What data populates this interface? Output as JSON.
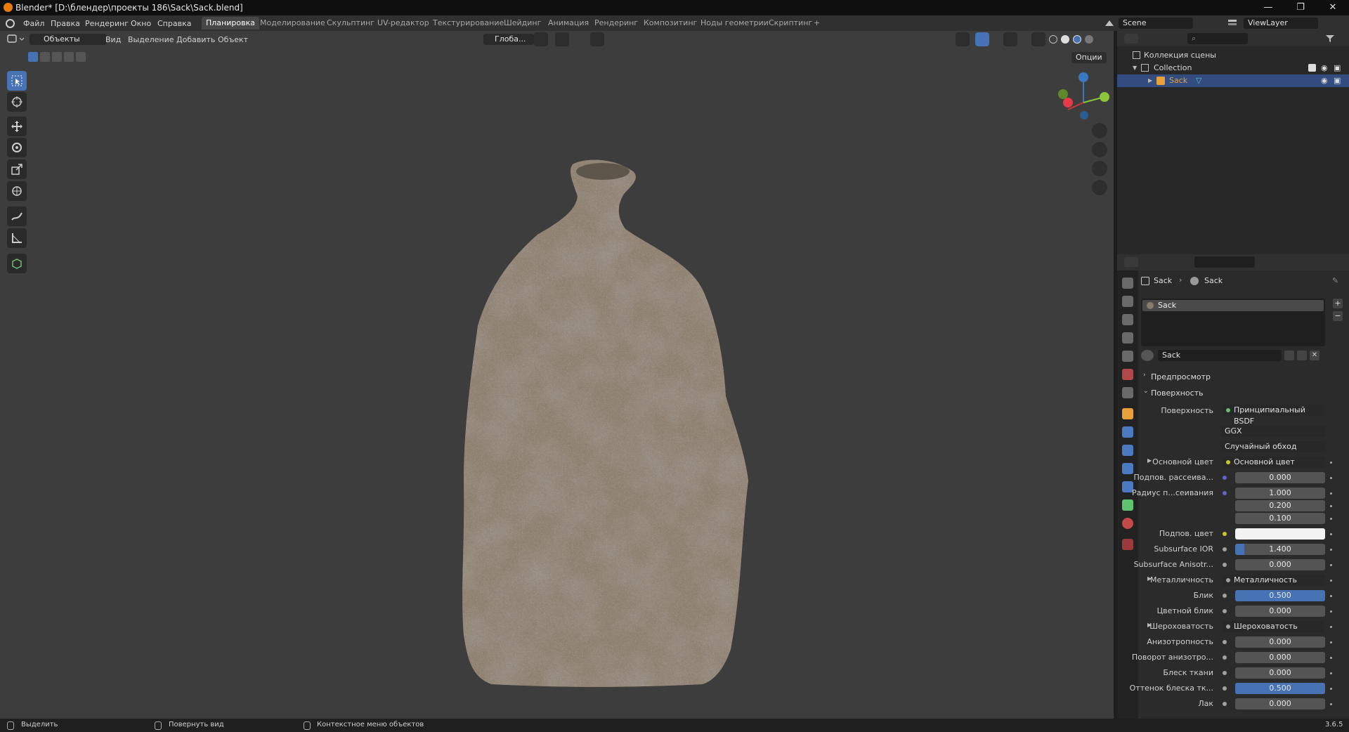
{
  "title_bar": {
    "title": "Blender* [D:\\блендер\\проекты 186\\Sack\\Sack.blend]",
    "min": "—",
    "restore": "❐",
    "close": "✕"
  },
  "menu": [
    "Файл",
    "Правка",
    "Рендеринг",
    "Окно",
    "Справка"
  ],
  "workspaces": [
    "Планировка",
    "Моделирование",
    "Скульптинг",
    "UV-редактор",
    "Текстурирование",
    "Шейдинг",
    "Анимация",
    "Рендеринг",
    "Композитинг",
    "Ноды геометрии",
    "Скриптинг"
  ],
  "add_workspace": "+",
  "scene": {
    "name": "Scene",
    "view_layer": "ViewLayer"
  },
  "viewport_header": {
    "mode": "Объекты",
    "menus": [
      "Вид",
      "Выделение",
      "Добавить",
      "Объект"
    ],
    "orientation": "Глоба...",
    "options": "Опции"
  },
  "outliner": {
    "scene_collection": "Коллекция сцены",
    "collection": "Collection",
    "object": "Sack"
  },
  "properties": {
    "breadcrumb": [
      "Sack",
      "Sack"
    ],
    "material_slot": "Sack",
    "material_name": "Sack",
    "sections": {
      "preview": "Предпросмотр",
      "surface": "Поверхность"
    },
    "surface_label": "Поверхность",
    "surface_value": "Принципиальный BSDF",
    "distribution": "GGX",
    "subsurface_method": "Случайный обход",
    "rows": [
      {
        "label": "Основной цвет",
        "kind": "link",
        "value": "Основной цвет",
        "socket": "#c7c729",
        "arrow": true
      },
      {
        "label": "Подпов. рассеива...",
        "kind": "num",
        "value": "0.000",
        "socket": "#6363c7",
        "fill": 0
      },
      {
        "label": "Радиус п...сеивания",
        "kind": "num",
        "value": "1.000",
        "socket": "#6363c7",
        "fill": 0
      },
      {
        "label": "",
        "kind": "num",
        "value": "0.200",
        "socket": "",
        "fill": 0
      },
      {
        "label": "",
        "kind": "num",
        "value": "0.100",
        "socket": "",
        "fill": 0
      },
      {
        "label": "Подпов. цвет",
        "kind": "color",
        "value": "",
        "socket": "#c7c729",
        "color": "#f2f2f2"
      },
      {
        "label": "Subsurface IOR",
        "kind": "num",
        "value": "1.400",
        "socket": "#a1a1a1",
        "fill": 0.1
      },
      {
        "label": "Subsurface Anisotr...",
        "kind": "num",
        "value": "0.000",
        "socket": "#a1a1a1",
        "fill": 0
      },
      {
        "label": "Металличность",
        "kind": "link",
        "value": "Металличность",
        "socket": "#a1a1a1",
        "arrow": true
      },
      {
        "label": "Блик",
        "kind": "num",
        "value": "0.500",
        "socket": "#a1a1a1",
        "fill": 1.0
      },
      {
        "label": "Цветной блик",
        "kind": "num",
        "value": "0.000",
        "socket": "#a1a1a1",
        "fill": 0
      },
      {
        "label": "Шероховатость",
        "kind": "link",
        "value": "Шероховатость",
        "socket": "#a1a1a1",
        "arrow": true
      },
      {
        "label": "Анизотропность",
        "kind": "num",
        "value": "0.000",
        "socket": "#a1a1a1",
        "fill": 0
      },
      {
        "label": "Поворот анизотро...",
        "kind": "num",
        "value": "0.000",
        "socket": "#a1a1a1",
        "fill": 0
      },
      {
        "label": "Блеск ткани",
        "kind": "num",
        "value": "0.000",
        "socket": "#a1a1a1",
        "fill": 0
      },
      {
        "label": "Оттенок блеска тк...",
        "kind": "num",
        "value": "0.500",
        "socket": "#a1a1a1",
        "fill": 1.0
      },
      {
        "label": "Лак",
        "kind": "num",
        "value": "0.000",
        "socket": "#a1a1a1",
        "fill": 0
      }
    ]
  },
  "statusbar": {
    "select": "Выделить",
    "rotate": "Повернуть вид",
    "context": "Контекстное меню объектов",
    "version": "3.6.5"
  },
  "colors": {
    "accent": "#4772b3",
    "selected_row": "#334d80",
    "object_orange": "#e8a03a",
    "viewport_bg": "#3d3d3d"
  }
}
